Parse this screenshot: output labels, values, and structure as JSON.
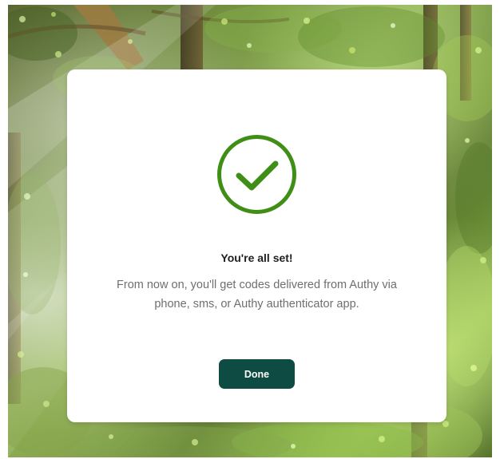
{
  "dialog": {
    "title": "You're all set!",
    "message": "From now on, you'll get codes delivered from Authy via phone, sms, or Authy authenticator app.",
    "done_label": "Done"
  },
  "icons": {
    "success": "check-circle-icon"
  },
  "colors": {
    "success_green": "#3f8f16",
    "button_background": "#0d4b43",
    "button_text": "#ffffff",
    "title_text": "#1f1f1f",
    "message_text": "#6f6f6f",
    "card_background": "#ffffff"
  }
}
